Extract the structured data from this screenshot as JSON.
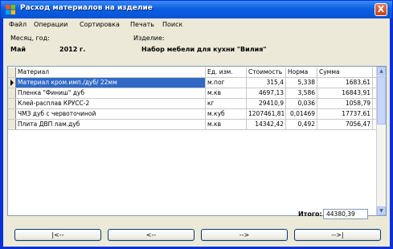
{
  "window": {
    "title": "Расход материалов на изделие",
    "close_glyph": "X"
  },
  "menu": [
    "Файл",
    "Операции",
    "Сортировка",
    "Печать",
    "Поиск"
  ],
  "header": {
    "period_label": "Месяц, год:",
    "product_label": "Изделие:",
    "month": "Май",
    "year": "2012 г.",
    "product": "Набор мебели для кухни \"Вилия\""
  },
  "table": {
    "columns": [
      "Материал",
      "Ед. изм.",
      "Стоимость",
      "Норма",
      "Сумма"
    ],
    "rows": [
      {
        "material": "Материал кром.имп./дуб/ 22мм",
        "unit": "м.пог",
        "cost": "315,4",
        "norm": "5,338",
        "sum": "1683,61"
      },
      {
        "material": "Пленка \"Финиш\" дуб",
        "unit": "м.кв",
        "cost": "4697,13",
        "norm": "3,586",
        "sum": "16843,91"
      },
      {
        "material": "Клей-расплав КРУСС-2",
        "unit": "кг",
        "cost": "29410,9",
        "norm": "0,036",
        "sum": "1058,79"
      },
      {
        "material": "ЧМЗ дуб с червоточиной",
        "unit": "м.куб",
        "cost": "1207461,81",
        "norm": "0,01469",
        "sum": "17737,61"
      },
      {
        "material": "Плита ДВП лам.дуб",
        "unit": "м.кв",
        "cost": "14342,42",
        "norm": "0,492",
        "sum": "7056,47"
      }
    ],
    "selected_row": 0
  },
  "total": {
    "label": "Итого:",
    "value": "44380,39"
  },
  "nav_buttons": [
    "|<--",
    "<--",
    "-->",
    "-->|"
  ],
  "colors": {
    "titlebar": "#0a5fe0",
    "selection": "#316ac5",
    "face": "#ece9d8"
  }
}
